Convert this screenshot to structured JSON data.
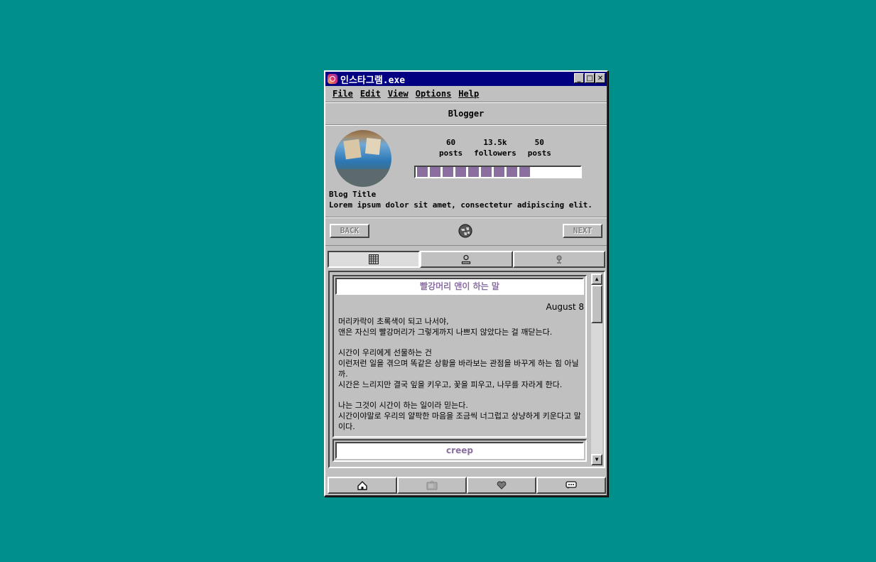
{
  "window": {
    "title": "인스타그램.exe",
    "minimize": "_",
    "maximize": "□",
    "close": "✕"
  },
  "menu": [
    "File",
    "Edit",
    "View",
    "Options",
    "Help"
  ],
  "header": {
    "username": "Blogger"
  },
  "profile": {
    "stats": [
      {
        "value": "60",
        "label": "posts"
      },
      {
        "value": "13.5k",
        "label": "followers"
      },
      {
        "value": "50",
        "label": "posts"
      }
    ],
    "progress_segments_filled": 9,
    "blog_title": "Blog Title",
    "bio": "Lorem ipsum dolor sit amet, consectetur adipiscing elit."
  },
  "nav": {
    "back_label": "BACK",
    "next_label": "NEXT"
  },
  "tabs": [
    {
      "icon": "grid-icon",
      "active": true
    },
    {
      "icon": "user-icon",
      "active": false
    },
    {
      "icon": "pin-icon",
      "active": false
    }
  ],
  "posts": [
    {
      "title": "빨강머리 앤이 하는 말",
      "date": "August 8",
      "paragraphs": [
        [
          "머리카락이 초록색이 되고 나서야,",
          "앤은 자신의 빨강머리가 그렇게까지 나쁘지 않았다는 걸 깨닫는다."
        ],
        [
          "시간이 우리에게 선물하는 건",
          "이런저런 일을 겪으며 똑같은 상황을 바라보는 관점을 바꾸게 하는 힘 아닐까.",
          "시간은 느리지만 결국 잎을 키우고, 꽃을 피우고, 나무를 자라게 한다."
        ],
        [
          "나는 그것이 시간이 하는 일이라 믿는다.",
          "시간이야말로 우리의 얄팍한 마음을 조금씩 너그럽고 상냥하게 키운다고 말이다."
        ]
      ]
    },
    {
      "title": "creep"
    }
  ],
  "bottom_nav": [
    "home-icon",
    "tv-icon",
    "heart-icon",
    "chat-icon"
  ],
  "colors": {
    "desktop": "#008f8a",
    "titlebar": "#000080",
    "accent": "#8a6fa0",
    "chrome": "#c0c0c0"
  }
}
